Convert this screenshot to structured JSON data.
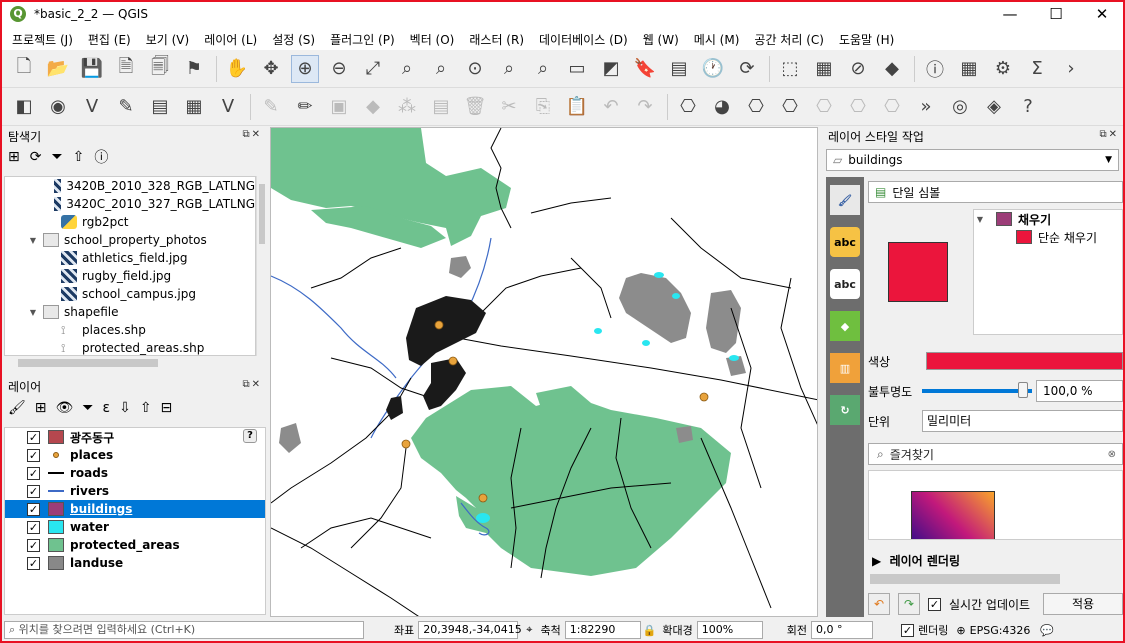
{
  "app": {
    "title": "*basic_2_2 — QGIS",
    "logo": "Q"
  },
  "window_buttons": {
    "minimize": "—",
    "maximize": "☐",
    "close": "✕"
  },
  "menu": [
    "프로젝트 (J)",
    "편집 (E)",
    "보기 (V)",
    "레이어 (L)",
    "설정 (S)",
    "플러그인 (P)",
    "벡터 (O)",
    "래스터 (R)",
    "데이터베이스 (D)",
    "웹 (W)",
    "메시 (M)",
    "공간 처리 (C)",
    "도움말 (H)"
  ],
  "browser": {
    "title": "탐색기",
    "items": [
      {
        "label": "3420B_2010_328_RGB_LATLNG",
        "type": "raster",
        "indent": 3
      },
      {
        "label": "3420C_2010_327_RGB_LATLNG",
        "type": "raster",
        "indent": 3
      },
      {
        "label": "rgb2pct",
        "type": "python",
        "indent": 3
      },
      {
        "label": "school_property_photos",
        "type": "folder",
        "indent": 2,
        "expanded": true
      },
      {
        "label": "athletics_field.jpg",
        "type": "raster",
        "indent": 3
      },
      {
        "label": "rugby_field.jpg",
        "type": "raster",
        "indent": 3
      },
      {
        "label": "school_campus.jpg",
        "type": "raster",
        "indent": 3
      },
      {
        "label": "shapefile",
        "type": "folder",
        "indent": 2,
        "expanded": true
      },
      {
        "label": "places.shp",
        "type": "shp",
        "indent": 3
      },
      {
        "label": "protected_areas.shp",
        "type": "shp",
        "indent": 3
      }
    ]
  },
  "layers_panel": {
    "title": "레이어",
    "layers": [
      {
        "name": "광주동구",
        "symbol": "fill",
        "color": "#b5474e",
        "checked": true,
        "selected": false,
        "help": "?"
      },
      {
        "name": "places",
        "symbol": "point",
        "color": "#e8a33c",
        "checked": true,
        "selected": false
      },
      {
        "name": "roads",
        "symbol": "line",
        "color": "#000000",
        "checked": true,
        "selected": false
      },
      {
        "name": "rivers",
        "symbol": "line",
        "color": "#3d6ac6",
        "checked": true,
        "selected": false
      },
      {
        "name": "buildings",
        "symbol": "fill",
        "color": "#9c3d78",
        "checked": true,
        "selected": true
      },
      {
        "name": "water",
        "symbol": "fill",
        "color": "#29e6f0",
        "checked": true,
        "selected": false
      },
      {
        "name": "protected_areas",
        "symbol": "fill",
        "color": "#6fc28f",
        "checked": true,
        "selected": false
      },
      {
        "name": "landuse",
        "symbol": "fill",
        "color": "#888888",
        "checked": true,
        "selected": false
      }
    ]
  },
  "style_panel": {
    "title": "레이어 스타일 작업",
    "layer": "buildings",
    "renderer": "단일 심볼",
    "symbol_tree": [
      "채우기",
      "단순 채우기"
    ],
    "color_label": "색상",
    "fill_color": "#eb153c",
    "opacity_label": "불투명도",
    "opacity": "100,0 %",
    "unit_label": "단위",
    "unit": "밀리미터",
    "favorites_placeholder": "즐겨찾기",
    "layer_rendering": "레이어 렌더링",
    "live_update": "실시간 업데이트",
    "apply": "적용",
    "tabs_icons": [
      "paintbrush-icon",
      "label-icon",
      "abc-icon",
      "3d-cube-icon",
      "diagram-icon",
      "history-icon"
    ]
  },
  "statusbar": {
    "locate_placeholder": "위치를 찾으려면 입력하세요 (Ctrl+K)",
    "coordinate_label": "좌표",
    "coordinate": "20,3948,-34,0415",
    "scale_label": "축척",
    "scale": "1:82290",
    "magnifier_label": "확대경",
    "magnifier": "100%",
    "rotation_label": "회전",
    "rotation": "0,0 °",
    "render_label": "렌더링",
    "crs": "EPSG:4326"
  },
  "colors": {
    "protected": "#6fc28f",
    "landuse": "#8c8c8c",
    "water": "#29e6f0",
    "river": "#3d6ac6",
    "road": "#000000",
    "building": "#1a1a1a",
    "place": "#e8a33c"
  }
}
